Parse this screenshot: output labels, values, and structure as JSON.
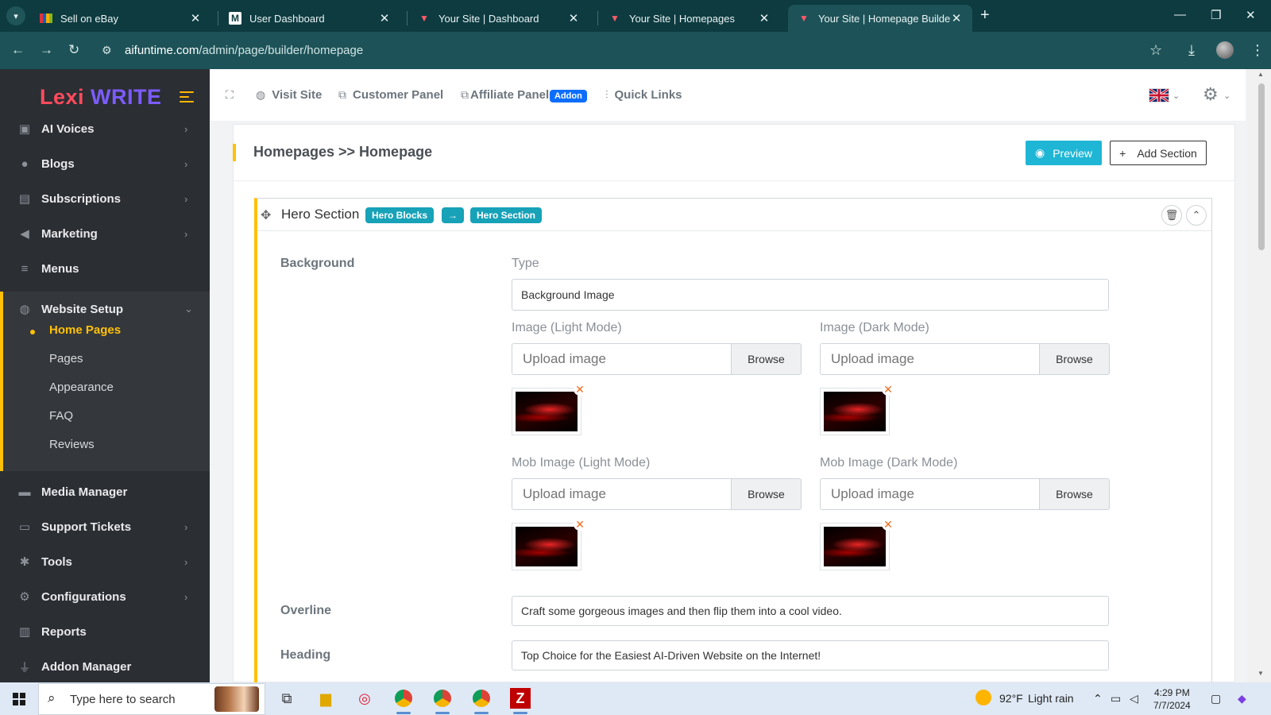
{
  "browser": {
    "tabs": [
      {
        "title": "Sell on eBay",
        "active": false
      },
      {
        "title": "User Dashboard",
        "active": false
      },
      {
        "title": "Your Site | Dashboard",
        "active": false
      },
      {
        "title": "Your Site | Homepages",
        "active": false
      },
      {
        "title": "Your Site | Homepage Builder",
        "active": true
      }
    ],
    "url_host": "aifuntime.com",
    "url_path": "/admin/page/builder/homepage"
  },
  "sidebar": {
    "logo_part1": "Lexi",
    "logo_part2": "WRITE",
    "items": [
      {
        "label": "AI Voices",
        "icon": "microphone-icon",
        "has_chevron": true
      },
      {
        "label": "Blogs",
        "icon": "blog-icon",
        "has_chevron": true
      },
      {
        "label": "Subscriptions",
        "icon": "money-icon",
        "has_chevron": true
      },
      {
        "label": "Marketing",
        "icon": "megaphone-icon",
        "has_chevron": true
      },
      {
        "label": "Menus",
        "icon": "menu-icon",
        "has_chevron": false
      },
      {
        "label": "Website Setup",
        "icon": "globe-icon",
        "expanded": true
      },
      {
        "label": "Media Manager",
        "icon": "folder-icon",
        "has_chevron": false
      },
      {
        "label": "Support Tickets",
        "icon": "ticket-icon",
        "has_chevron": true
      },
      {
        "label": "Tools",
        "icon": "tools-icon",
        "has_chevron": true
      },
      {
        "label": "Configurations",
        "icon": "gear-icon",
        "has_chevron": true
      },
      {
        "label": "Reports",
        "icon": "chart-icon",
        "has_chevron": false
      },
      {
        "label": "Addon Manager",
        "icon": "plug-icon",
        "has_chevron": false
      }
    ],
    "website_setup_children": [
      "Home Pages",
      "Pages",
      "Appearance",
      "FAQ",
      "Reviews"
    ],
    "active_child": "Home Pages"
  },
  "header": {
    "visit_site": "Visit Site",
    "customer_panel": "Customer Panel",
    "affiliate_panel": "Affiliate Panel",
    "addon_badge": "Addon",
    "quick_links": "Quick Links"
  },
  "page": {
    "title": "Homepages >> Homepage",
    "preview_label": "Preview",
    "add_section_label": "Add Section"
  },
  "hero": {
    "title": "Hero Section",
    "badge1": "Hero Blocks",
    "badge_arrow": "→",
    "badge2": "Hero Section",
    "background_label": "Background",
    "type_label": "Type",
    "type_value": "Background Image",
    "image_light_label": "Image (Light Mode)",
    "image_dark_label": "Image (Dark Mode)",
    "mob_light_label": "Mob Image (Light Mode)",
    "mob_dark_label": "Mob Image (Dark Mode)",
    "upload_placeholder": "Upload image",
    "browse_label": "Browse",
    "overline_label": "Overline",
    "overline_value": "Craft some gorgeous images and then flip them into a cool video.",
    "heading_label": "Heading",
    "heading_value": "Top Choice for the Easiest AI-Driven Website on the Internet!"
  },
  "taskbar": {
    "search_placeholder": "Type here to search",
    "temperature": "92°F",
    "weather": "Light rain",
    "time": "4:29 PM",
    "date": "7/7/2024"
  },
  "colors": {
    "accent_yellow": "#ffc107",
    "teal": "#17a2b8",
    "preview_blue": "#1fb6d6",
    "addon_blue": "#0d6efd",
    "sidebar_bg": "#2b2e33"
  }
}
